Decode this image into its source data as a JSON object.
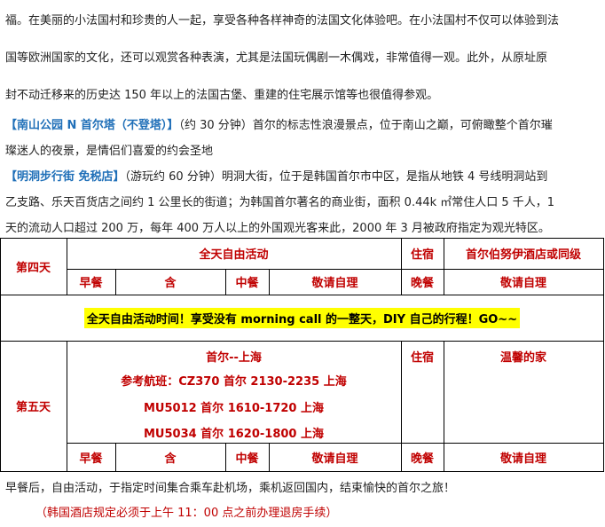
{
  "intro": {
    "line1": "福。在美丽的小法国村和珍贵的人一起，享受各种各样神奇的法国文化体验吧。在小法国村不仅可以体验到法",
    "line2": "国等欧洲国家的文化，还可以观赏各种表演，尤其是法国玩偶剧一木偶戏，非常值得一观。此外，从原址原",
    "line3": "封不动迁移来的历史达 150 年以上的法国古堡、重建的住宅展示馆等也很值得参观。",
    "namsan_name": "【南山公园 N 首尔塔（不登塔）】",
    "namsan_text": "（约 30 分钟）首尔的标志性浪漫景点，位于南山之巅，可俯瞰整个首尔璀",
    "namsan_text2": "璨迷人的夜景，是情侣们喜爱的约会圣地",
    "myeongdong_name": "【明洞步行街 免税店】",
    "myeongdong_text": "（游玩约 60 分钟）明洞大街，位于是韩国首尔市中区，是指从地铁 4 号线明洞站到",
    "myeongdong_text2": "乙支路、乐天百货店之间约 1 公里长的街道；为韩国首尔著名的商业街，面积 0.44k ㎡常住人口 5 千人，1",
    "myeongdong_text3": "天的流动人口超过 200 万，每年 400 万人以上的外国观光客来此，2000 年 3 月被政府指定为观光特区。"
  },
  "day4": {
    "label": "第四天",
    "activity": "全天自由活动",
    "stay_label": "住宿",
    "hotel": "首尔伯努伊酒店或同级",
    "breakfast_label": "早餐",
    "breakfast": "含",
    "lunch_label": "中餐",
    "lunch": "敬请自理",
    "dinner_label": "晚餐",
    "dinner": "敬请自理",
    "note": "全天自由活动时间！享受没有 morning call 的一整天，DIY 自己的行程！GO~~"
  },
  "day5": {
    "label": "第五天",
    "route": "首尔--上海",
    "flight_ref": "参考航班：CZ370 首尔 2130-2235 上海",
    "flight2": "MU5012 首尔 1610-1720 上海",
    "flight3": "MU5034 首尔 1620-1800 上海",
    "stay_label": "住宿",
    "hotel": "温馨的家",
    "breakfast_label": "早餐",
    "breakfast": "含",
    "lunch_label": "中餐",
    "lunch": "敬请自理",
    "dinner_label": "晚餐",
    "dinner": "敬请自理"
  },
  "footer": {
    "text": "早餐后，自由活动，于指定时间集合乘车赴机场，乘机返回国内，结束愉快的首尔之旅！",
    "note": "（韩国酒店规定必须于上午 11：00 点之前办理退房手续）"
  }
}
